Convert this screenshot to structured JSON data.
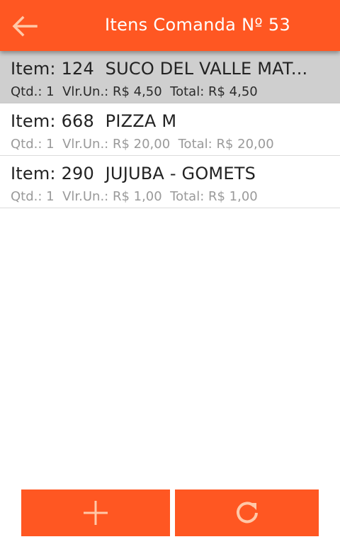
{
  "appbar": {
    "title": "Itens Comanda Nº 53",
    "back_icon": "arrow-left-icon",
    "color": "#ff5722"
  },
  "items": [
    {
      "item_label": "Item:",
      "code": "124",
      "name": "SUCO DEL VALLE MAT...",
      "qtd": "Qtd.: 1",
      "unit_price": "Vlr.Un.: R$ 4,50",
      "total": "Total: R$ 4,50",
      "selected": true
    },
    {
      "item_label": "Item:",
      "code": "668",
      "name": "PIZZA M",
      "qtd": "Qtd.: 1",
      "unit_price": "Vlr.Un.: R$ 20,00",
      "total": "Total: R$ 20,00",
      "selected": false
    },
    {
      "item_label": "Item:",
      "code": "290",
      "name": "JUJUBA - GOMETS",
      "qtd": "Qtd.: 1",
      "unit_price": "Vlr.Un.: R$ 1,00",
      "total": "Total: R$ 1,00",
      "selected": false
    }
  ],
  "actions": {
    "add_icon": "plus-icon",
    "refresh_icon": "refresh-icon",
    "color": "#ff5722"
  }
}
